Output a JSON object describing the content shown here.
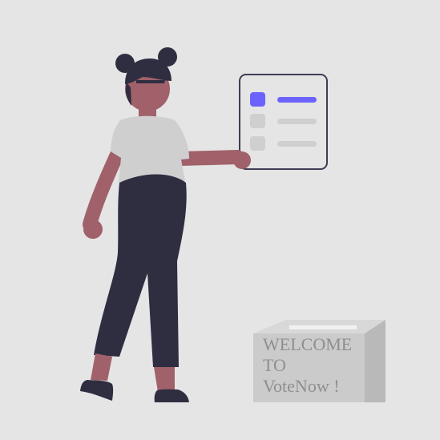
{
  "illustration": {
    "box_label_lines": [
      "WELCOME",
      "TO",
      "VoteNow !"
    ]
  },
  "colors": {
    "background": "#e5e5e5",
    "accent": "#6c63ff",
    "skin": "#a0616a",
    "hair": "#2f2e41",
    "pants": "#2f2e41",
    "shirt": "#cfcfcf",
    "box_front": "#cbcbcb",
    "box_side": "#b9b9b9",
    "box_top": "#d8d8d8",
    "text_gray": "#8f8f8f",
    "card_border": "#3f3d56",
    "option_gray": "#cfcfcf"
  }
}
